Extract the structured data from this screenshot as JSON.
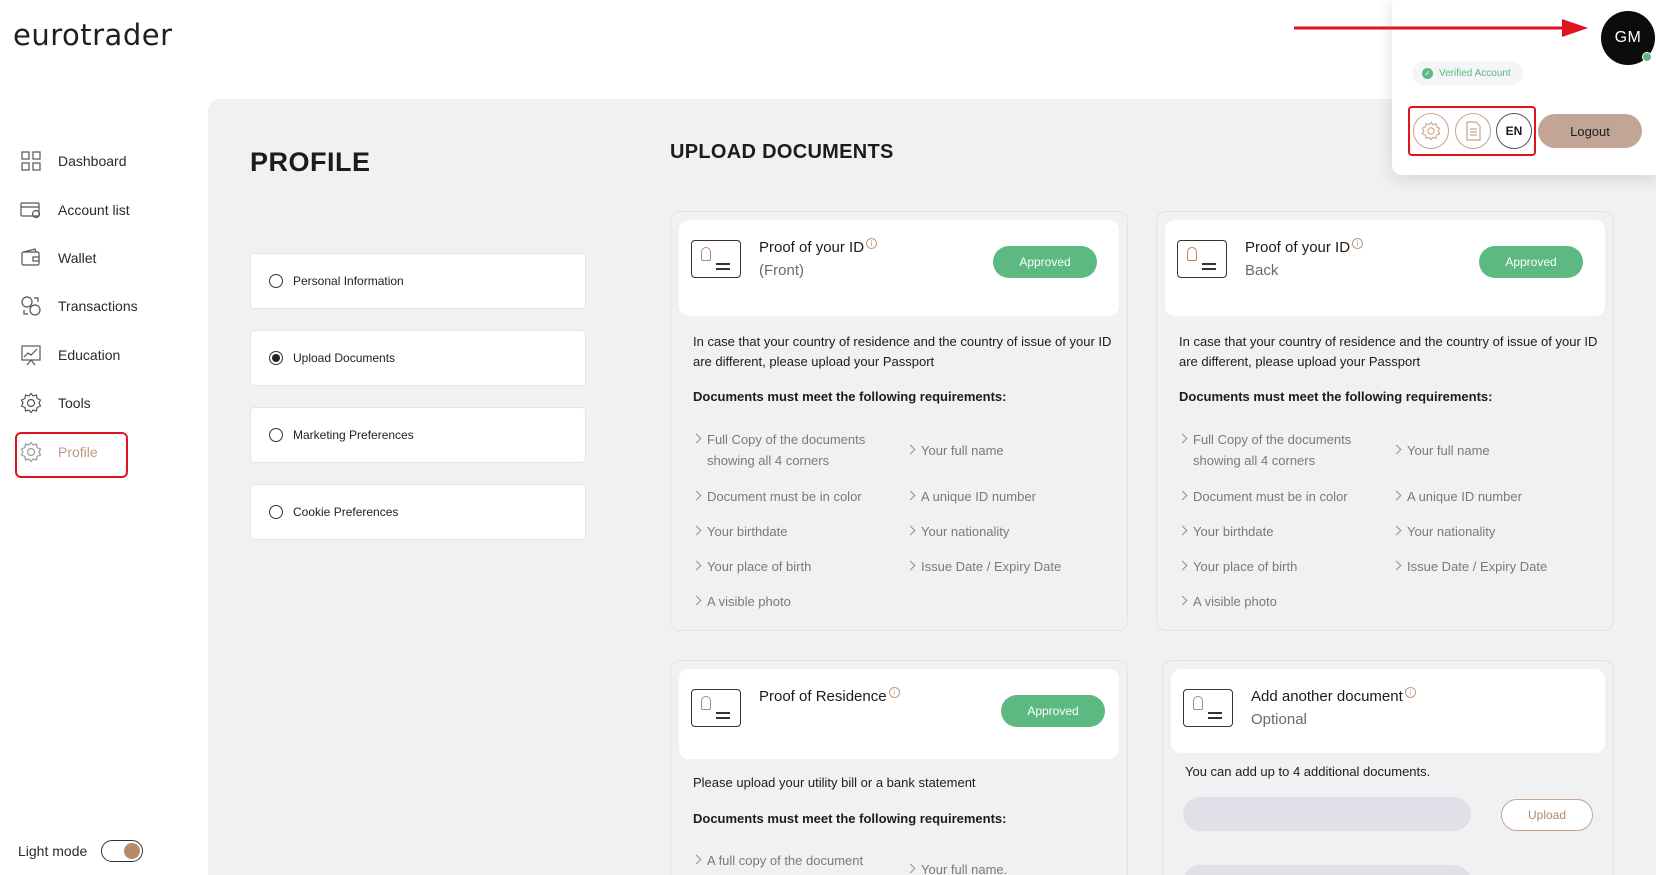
{
  "brand": {
    "logo_text": "eurotrader"
  },
  "sidebar": {
    "items": [
      {
        "label": "Dashboard",
        "icon": "dashboard-grid-icon"
      },
      {
        "label": "Account list",
        "icon": "account-card-icon"
      },
      {
        "label": "Wallet",
        "icon": "wallet-icon"
      },
      {
        "label": "Transactions",
        "icon": "transactions-icon"
      },
      {
        "label": "Education",
        "icon": "education-chart-icon"
      },
      {
        "label": "Tools",
        "icon": "tools-gear-icon"
      },
      {
        "label": "Profile",
        "icon": "profile-gear-icon",
        "active": true
      }
    ],
    "light_mode_label": "Light mode"
  },
  "profile": {
    "title": "PROFILE",
    "menu": [
      {
        "label": "Personal Information",
        "selected": false
      },
      {
        "label": "Upload Documents",
        "selected": true
      },
      {
        "label": "Marketing Preferences",
        "selected": false
      },
      {
        "label": "Cookie Preferences",
        "selected": false
      }
    ]
  },
  "upload": {
    "title": "UPLOAD DOCUMENTS",
    "cards": [
      {
        "title": "Proof of your ID",
        "subtitle": "(Front)",
        "status": "Approved",
        "desc": "In case that your country of residence and the country of issue of your ID are different, please upload your Passport",
        "req_title": "Documents must meet the following requirements:",
        "req_left": [
          "Full Copy of the documents showing all 4 corners",
          "Document must be in color",
          "Your birthdate",
          "Your place of birth",
          "A visible photo"
        ],
        "req_right": [
          "Your full name",
          "A unique ID number",
          "Your nationality",
          "Issue Date / Expiry Date"
        ]
      },
      {
        "title": "Proof of your ID",
        "subtitle": "Back",
        "status": "Approved",
        "desc": "In case that your country of residence and the country of issue of your ID are different, please upload your Passport",
        "req_title": "Documents must meet the following requirements:",
        "req_left": [
          "Full Copy of the documents showing all 4 corners",
          "Document must be in color",
          "Your birthdate",
          "Your place of birth",
          "A visible photo"
        ],
        "req_right": [
          "Your full name",
          "A unique ID number",
          "Your nationality",
          "Issue Date / Expiry Date"
        ]
      },
      {
        "title": "Proof of Residence",
        "status": "Approved",
        "desc": "Please upload your utility bill or a bank statement",
        "req_title": "Documents must meet the following requirements:",
        "req_left": [
          "A full copy of the document"
        ],
        "req_right": [
          "Your full name."
        ]
      },
      {
        "title": "Add another document",
        "subtitle": "Optional",
        "desc": "You can add up to 4 additional documents.",
        "upload_label": "Upload"
      }
    ]
  },
  "user_menu": {
    "initials": "GM",
    "verified_label": "Verified Account",
    "lang": "EN",
    "logout_label": "Logout"
  },
  "colors": {
    "accent": "#c3a595",
    "approved": "#5bb981",
    "highlight": "#e0141e"
  }
}
